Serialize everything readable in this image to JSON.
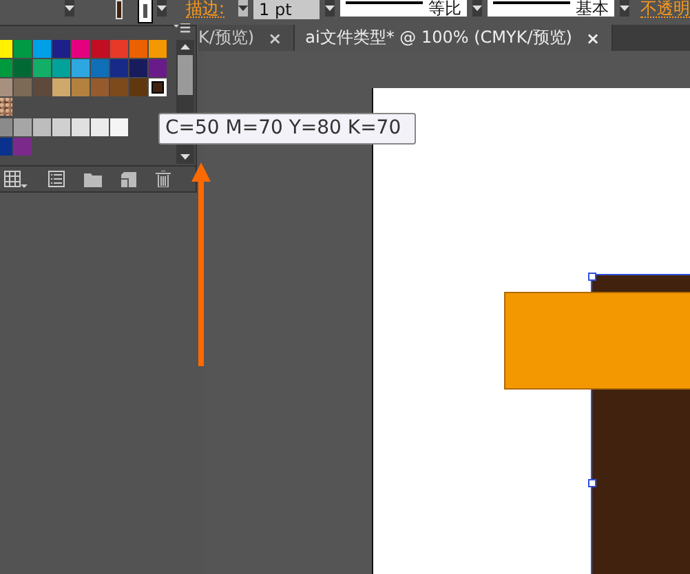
{
  "control_bar": {
    "stroke_label": "描边:",
    "weight": "1 pt",
    "profile": "等比",
    "brush": "基本",
    "opacity_label": "不透明"
  },
  "swatches_panel": {
    "rows": [
      {
        "swatches": [
          {
            "kind": "color",
            "color": "#fff100",
            "selected": false
          },
          {
            "kind": "color",
            "color": "#009944",
            "selected": false
          },
          {
            "kind": "color",
            "color": "#00a0e9",
            "selected": false
          },
          {
            "kind": "color",
            "color": "#1d2088",
            "selected": false
          },
          {
            "kind": "color",
            "color": "#e4007f",
            "selected": false
          },
          {
            "kind": "color",
            "color": "#c30d23",
            "selected": false
          },
          {
            "kind": "color",
            "color": "#e83828",
            "selected": false
          },
          {
            "kind": "color",
            "color": "#eb6100",
            "selected": false
          },
          {
            "kind": "color",
            "color": "#f39800",
            "selected": false
          }
        ]
      },
      {
        "swatches": [
          {
            "kind": "color",
            "color": "#009a3e",
            "selected": false
          },
          {
            "kind": "color",
            "color": "#006934",
            "selected": false
          },
          {
            "kind": "color",
            "color": "#13ae67",
            "selected": false
          },
          {
            "kind": "color",
            "color": "#00a29a",
            "selected": false
          },
          {
            "kind": "color",
            "color": "#2ea7e0",
            "selected": false
          },
          {
            "kind": "color",
            "color": "#0f6fb8",
            "selected": false
          },
          {
            "kind": "color",
            "color": "#172a88",
            "selected": false
          },
          {
            "kind": "color",
            "color": "#191c5c",
            "selected": false
          },
          {
            "kind": "color",
            "color": "#6a1b8a",
            "selected": false
          }
        ]
      },
      {
        "swatches": [
          {
            "kind": "color",
            "color": "#a8907f",
            "selected": false
          },
          {
            "kind": "color",
            "color": "#7d6a56",
            "selected": false
          },
          {
            "kind": "color",
            "color": "#5e4a3c",
            "selected": false
          },
          {
            "kind": "color",
            "color": "#cfa86b",
            "selected": false
          },
          {
            "kind": "color",
            "color": "#b3823f",
            "selected": false
          },
          {
            "kind": "color",
            "color": "#955b2f",
            "selected": false
          },
          {
            "kind": "color",
            "color": "#7d4a1c",
            "selected": false
          },
          {
            "kind": "color",
            "color": "#603810",
            "selected": false
          },
          {
            "kind": "color",
            "color": "#40220f",
            "selected": true
          }
        ]
      },
      {
        "swatches": [
          {
            "kind": "texture",
            "color": "#a07050",
            "selected": false
          }
        ]
      },
      {
        "swatches": [
          {
            "kind": "color",
            "color": "#8b8b8b",
            "selected": false
          },
          {
            "kind": "color",
            "color": "#a6a6a6",
            "selected": false
          },
          {
            "kind": "color",
            "color": "#bdbdbd",
            "selected": false
          },
          {
            "kind": "color",
            "color": "#d0d0d0",
            "selected": false
          },
          {
            "kind": "color",
            "color": "#e0e0e0",
            "selected": false
          },
          {
            "kind": "color",
            "color": "#ebebeb",
            "selected": false
          },
          {
            "kind": "color",
            "color": "#f5f5f5",
            "selected": false
          }
        ]
      },
      {
        "swatches": [
          {
            "kind": "color",
            "color": "#0b318f",
            "selected": false
          },
          {
            "kind": "color",
            "color": "#7b2a8c",
            "selected": false
          }
        ]
      }
    ]
  },
  "tooltip": "C=50 M=70 Y=80 K=70",
  "tabs": [
    {
      "label": "K/预览)",
      "close": "×",
      "selected": false
    },
    {
      "label": "ai文件类型* @ 100% (CMYK/预览)",
      "close": "×",
      "selected": true
    }
  ]
}
